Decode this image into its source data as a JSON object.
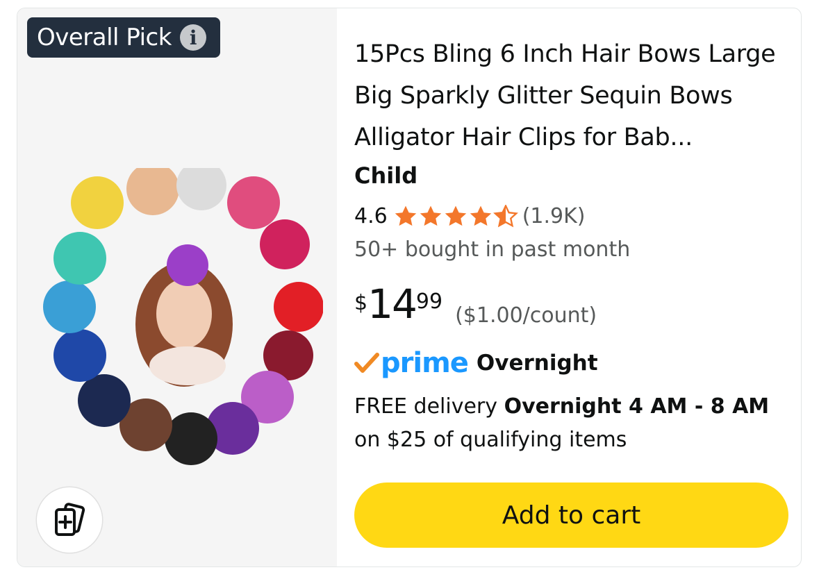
{
  "badge": {
    "label": "Overall Pick",
    "icon": "info-icon"
  },
  "product": {
    "title": "15Pcs Bling 6 Inch Hair Bows Large Big Sparkly Glitter Sequin Bows Alligator Hair Clips for Bab...",
    "brand": "Child",
    "rating": "4.6",
    "stars": 4.6,
    "rating_count": "(1.9K)",
    "bought": "50+ bought in past month",
    "price": {
      "symbol": "$",
      "whole": "14",
      "fraction": "99"
    },
    "unit_price": "($1.00/count)"
  },
  "prime": {
    "logo": "prime",
    "label": "Overnight"
  },
  "delivery": {
    "prefix": "FREE delivery ",
    "bold": "Overnight 4 AM - 8 AM",
    "suffix": " on $25 of qualifying items"
  },
  "actions": {
    "add_to_cart": "Add to cart",
    "compare_icon": "compare-icon"
  },
  "colors": {
    "badge_bg": "#232f3e",
    "star": "#f3772b",
    "prime_blue": "#1a98ff",
    "cart_yellow": "#ffd814"
  }
}
